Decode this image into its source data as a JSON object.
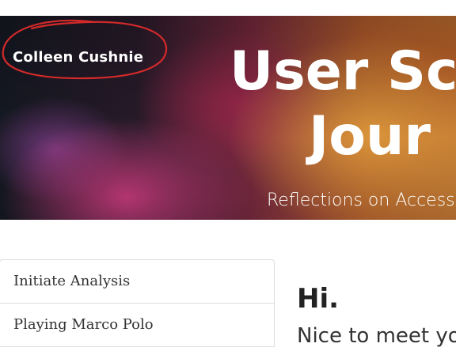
{
  "header": {
    "site_name": "Colleen Cushnie",
    "title_line1": "User Sc",
    "title_line2": "Jour",
    "subtitle": "Reflections on Accessb"
  },
  "sidebar": {
    "items": [
      {
        "label": "Initiate Analysis"
      },
      {
        "label": "Playing Marco Polo"
      }
    ]
  },
  "main": {
    "greeting": "Hi.",
    "intro": "Nice to meet yo"
  },
  "colors": {
    "annotation": "#d42a2a",
    "text_dark": "#222222",
    "border": "#dddddd"
  }
}
